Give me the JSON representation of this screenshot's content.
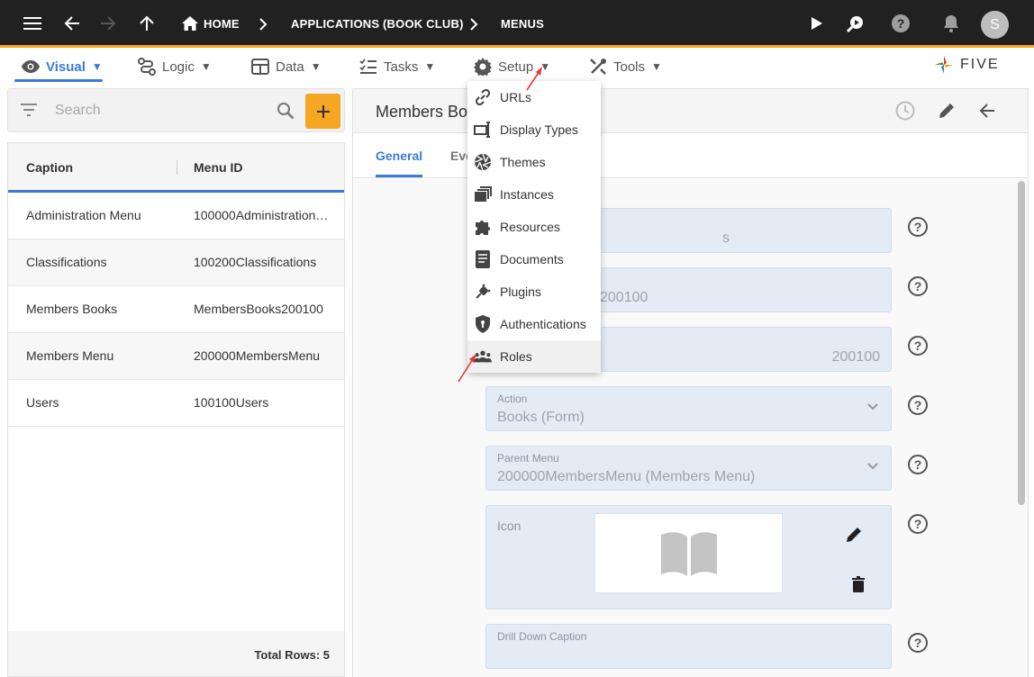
{
  "topbar": {
    "breadcrumbs": [
      "HOME",
      "APPLICATIONS (BOOK CLUB)",
      "MENUS"
    ],
    "avatar_initial": "S"
  },
  "menubar": {
    "items": [
      {
        "label": "Visual",
        "active": true
      },
      {
        "label": "Logic"
      },
      {
        "label": "Data"
      },
      {
        "label": "Tasks"
      },
      {
        "label": "Setup"
      },
      {
        "label": "Tools"
      }
    ],
    "logo_text": "FIVE"
  },
  "search": {
    "placeholder": "Search"
  },
  "list": {
    "columns": [
      "Caption",
      "Menu ID"
    ],
    "rows": [
      {
        "caption": "Administration Menu",
        "menu_id": "100000Administration…"
      },
      {
        "caption": "Classifications",
        "menu_id": "100200Classifications"
      },
      {
        "caption": "Members Books",
        "menu_id": "MembersBooks200100"
      },
      {
        "caption": "Members Menu",
        "menu_id": "200000MembersMenu"
      },
      {
        "caption": "Users",
        "menu_id": "100100Users"
      }
    ],
    "footer": "Total Rows: 5"
  },
  "detail": {
    "title": "Members Bo",
    "tabs": [
      "General",
      "Eve"
    ],
    "fields": {
      "caption_partial": "s",
      "menu_id_partial": "200100",
      "menu_order": "200100",
      "action_label": "Action",
      "action_value": "Books (Form)",
      "parent_menu_label": "Parent Menu",
      "parent_menu_value": "200000MembersMenu (Members Menu)",
      "icon_label": "Icon",
      "drill_down_label": "Drill Down Caption"
    }
  },
  "setup_menu": {
    "items": [
      "URLs",
      "Display Types",
      "Themes",
      "Instances",
      "Resources",
      "Documents",
      "Plugins",
      "Authentications",
      "Roles"
    ],
    "highlighted": "Roles"
  },
  "colors": {
    "accent": "#3a7bd5",
    "brand": "#f5a623",
    "topbar": "#212121",
    "arrow": "#e53935"
  }
}
